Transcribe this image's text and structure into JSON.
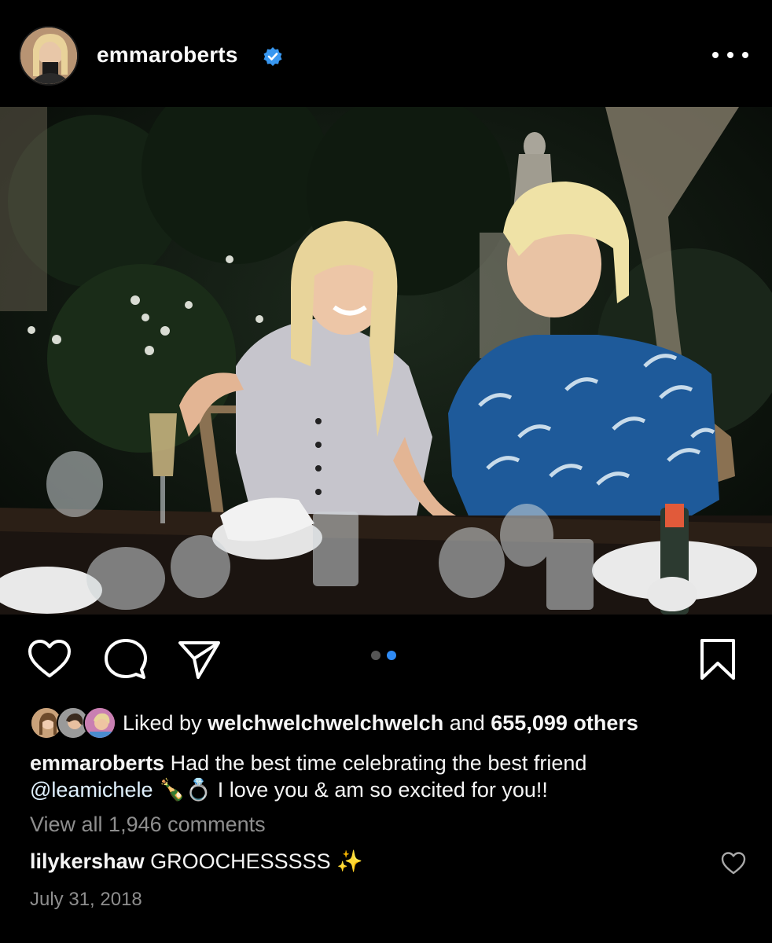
{
  "header": {
    "username": "emmaroberts",
    "verified": true,
    "more_icon": "more-horizontal-icon"
  },
  "post": {
    "carousel": {
      "count": 2,
      "active_index": 1
    },
    "actions": [
      "heart-icon",
      "comment-icon",
      "share-icon",
      "bookmark-icon"
    ]
  },
  "likes": {
    "prefix": "Liked by ",
    "user": "welchwelchwelchwelch",
    "middle": " and ",
    "count": "655,099 others"
  },
  "caption": {
    "username": "emmaroberts",
    "text_part1": " Had the best time celebrating the best friend ",
    "mention": "@leamichele",
    "emoji": " 🍾💍 ",
    "text_part2": "I love you & am so excited for you!!"
  },
  "view_all": "View all 1,946 comments",
  "comment": {
    "username": "lilykershaw",
    "text": " GROOCHESSSSS ",
    "emoji": "✨"
  },
  "date": "July 31, 2018",
  "colors": {
    "background": "#000000",
    "accent_blue": "#2f8bf5",
    "muted_text": "#8e8e8e"
  }
}
